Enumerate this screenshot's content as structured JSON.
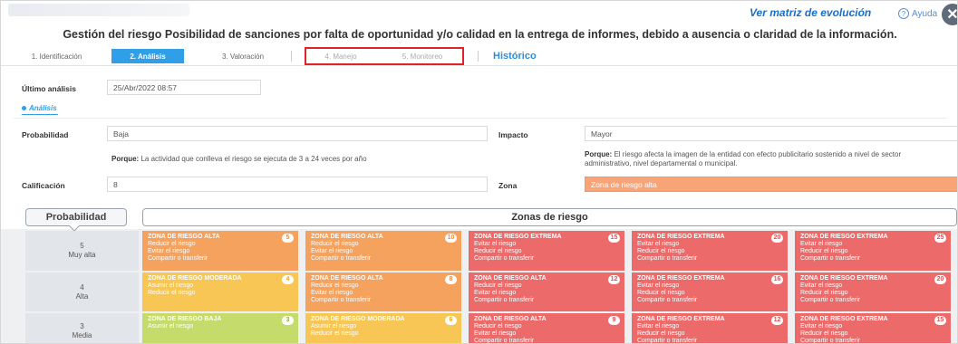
{
  "header": {
    "ver_matriz": "Ver matriz de evolución",
    "ayuda": "Ayuda",
    "close": "✕",
    "title": "Gestión del riesgo Posibilidad de sanciones por falta de oportunidad y/o calidad en la entrega de informes, debido a ausencia o claridad de la información."
  },
  "tabs": [
    "1. Identificación",
    "2. Análisis",
    "3. Valoración",
    "4. Manejo",
    "5. Monitoreo"
  ],
  "historico": "Histórico",
  "form": {
    "ultimo_label": "Último análisis",
    "ultimo_value": "25/Abr/2022 08:57",
    "analisis_link": "Análisis",
    "prob_label": "Probabilidad",
    "prob_value": "Baja",
    "impacto_label": "Impacto",
    "impacto_value": "Mayor",
    "porque_label": "Porque:",
    "porque_prob": "La actividad que conlleva el riesgo se ejecuta de 3 a 24 veces por año",
    "porque_impacto_l1": "El riesgo afecta la imagen de la entidad con efecto publicitario sostenido a nivel de sector",
    "porque_impacto_l2": "administrativo, nivel departamental o municipal.",
    "calif_label": "Calificación",
    "calif_value": "8",
    "zona_label": "Zona",
    "zona_value": "Zona de riesgo alta"
  },
  "matrix": {
    "prob_header": "Probabilidad",
    "zonas_header": "Zonas de riesgo",
    "rows": [
      {
        "num": "5",
        "name": "Muy alta",
        "cells": [
          {
            "title": "ZONA DE RIESGO ALTA",
            "score": "5",
            "lines": [
              "Reducir el riesgo",
              "Evitar el riesgo",
              "Compartir o transferir"
            ],
            "color": "alta"
          },
          {
            "title": "ZONA DE RIESGO ALTA",
            "score": "10",
            "lines": [
              "Reducir el riesgo",
              "Evitar el riesgo",
              "Compartir o transferir"
            ],
            "color": "alta"
          },
          {
            "title": "ZONA DE RIESGO EXTREMA",
            "score": "15",
            "lines": [
              "Evitar el riesgo",
              "Reducir el riesgo",
              "Compartir o transferir"
            ],
            "color": "ext"
          },
          {
            "title": "ZONA DE RIESGO EXTREMA",
            "score": "20",
            "lines": [
              "Evitar el riesgo",
              "Reducir el riesgo",
              "Compartir o transferir"
            ],
            "color": "ext"
          },
          {
            "title": "ZONA DE RIESGO EXTREMA",
            "score": "25",
            "lines": [
              "Evitar el riesgo",
              "Reducir el riesgo",
              "Compartir o transferir"
            ],
            "color": "ext"
          }
        ]
      },
      {
        "num": "4",
        "name": "Alta",
        "cells": [
          {
            "title": "ZONA DE RIESGO MODERADA",
            "score": "4",
            "lines": [
              "Asumir el riesgo",
              "Reducir el riesgo"
            ],
            "color": "mod"
          },
          {
            "title": "ZONA DE RIESGO ALTA",
            "score": "8",
            "lines": [
              "Reducir el riesgo",
              "Evitar el riesgo",
              "Compartir o transferir"
            ],
            "color": "alta"
          },
          {
            "title": "ZONA DE RIESGO ALTA",
            "score": "12",
            "lines": [
              "Reducir el riesgo",
              "Evitar el riesgo",
              "Compartir o transferir"
            ],
            "color": "ext"
          },
          {
            "title": "ZONA DE RIESGO EXTREMA",
            "score": "16",
            "lines": [
              "Evitar el riesgo",
              "Reducir el riesgo",
              "Compartir o transferir"
            ],
            "color": "ext"
          },
          {
            "title": "ZONA DE RIESGO EXTREMA",
            "score": "20",
            "lines": [
              "Evitar el riesgo",
              "Reducir el riesgo",
              "Compartir o transferir"
            ],
            "color": "ext"
          }
        ]
      },
      {
        "num": "3",
        "name": "Media",
        "cells": [
          {
            "title": "ZONA DE RIESGO BAJA",
            "score": "3",
            "lines": [
              "Asumir el riesgo"
            ],
            "color": "baja"
          },
          {
            "title": "ZONA DE RIESGO MODERADA",
            "score": "6",
            "lines": [
              "Asumir el riesgo",
              "Reducir el riesgo"
            ],
            "color": "mod"
          },
          {
            "title": "ZONA DE RIESGO ALTA",
            "score": "9",
            "lines": [
              "Reducir el riesgo",
              "Evitar el riesgo",
              "Compartir o transferir"
            ],
            "color": "ext"
          },
          {
            "title": "ZONA DE RIESGO EXTREMA",
            "score": "12",
            "lines": [
              "Evitar el riesgo",
              "Reducir el riesgo",
              "Compartir o transferir"
            ],
            "color": "ext"
          },
          {
            "title": "ZONA DE RIESGO EXTREMA",
            "score": "15",
            "lines": [
              "Evitar el riesgo",
              "Reducir el riesgo",
              "Compartir o transferir"
            ],
            "color": "ext"
          }
        ]
      }
    ]
  }
}
